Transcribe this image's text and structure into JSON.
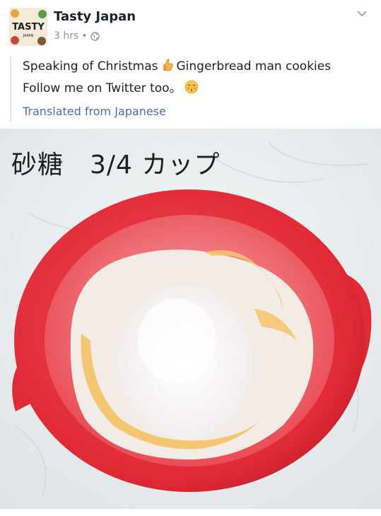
{
  "post": {
    "page_name": "Tasty Japan",
    "time": "3 hrs",
    "separator": "•",
    "privacy_icon": "globe-icon",
    "menu_icon": "chevron-down-icon",
    "avatar": {
      "logo_text": "TASTY",
      "logo_subtext": "JAPAN"
    },
    "text_line1_before": "Speaking of Christmas",
    "text_line1_emoji": "thumbs-up-emoji",
    "text_line1_after": "Gingerbread man cookies",
    "text_line2": "Follow me on Twitter too。",
    "text_line2_emoji": "kissing-face-emoji",
    "translated_label": "Translated from Japanese"
  },
  "photo": {
    "caption": "砂糖　3/4 カップ",
    "colors": {
      "bowl": "#e5323e",
      "marble": "#ebeeef",
      "flour": "#f3ece6",
      "egg": "#f4c46a"
    }
  }
}
